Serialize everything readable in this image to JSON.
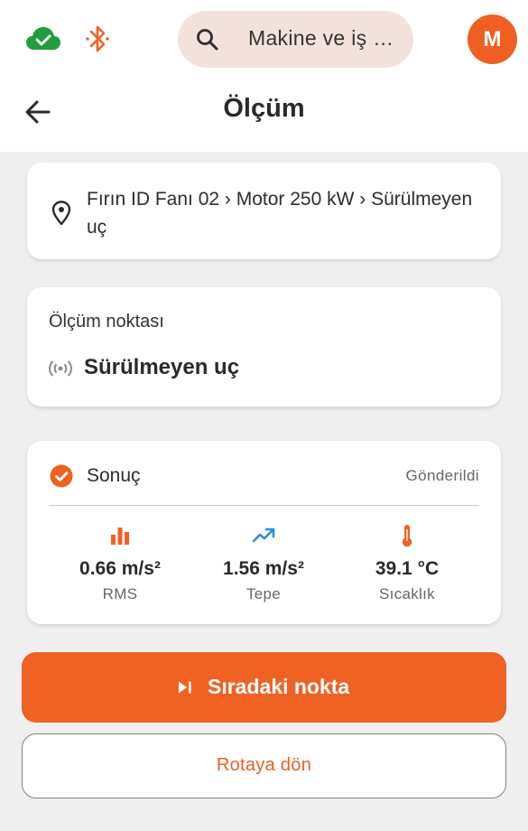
{
  "header": {
    "search_placeholder": "Makine ve iş …",
    "avatar_initial": "M",
    "title": "Ölçüm"
  },
  "location": {
    "path": "Fırın ID Fanı 02 › Motor 250 kW › Sürülmeyen uç"
  },
  "measurement_point": {
    "label": "Ölçüm noktası",
    "value": "Sürülmeyen uç"
  },
  "result": {
    "title": "Sonuç",
    "status": "Gönderildi",
    "metrics": [
      {
        "value": "0.66 m/s²",
        "label": "RMS",
        "icon": "bar-chart-icon"
      },
      {
        "value": "1.56 m/s²",
        "label": "Tepe",
        "icon": "trending-up-icon"
      },
      {
        "value": "39.1 °C",
        "label": "Sıcaklık",
        "icon": "thermometer-icon"
      }
    ]
  },
  "actions": {
    "next_label": "Sıradaki nokta",
    "back_label": "Rotaya dön"
  },
  "colors": {
    "accent": "#f06124",
    "cloud_ok": "#1f9d3f",
    "trend_blue": "#2a8fd6",
    "search_bg": "#f3e2dc"
  }
}
